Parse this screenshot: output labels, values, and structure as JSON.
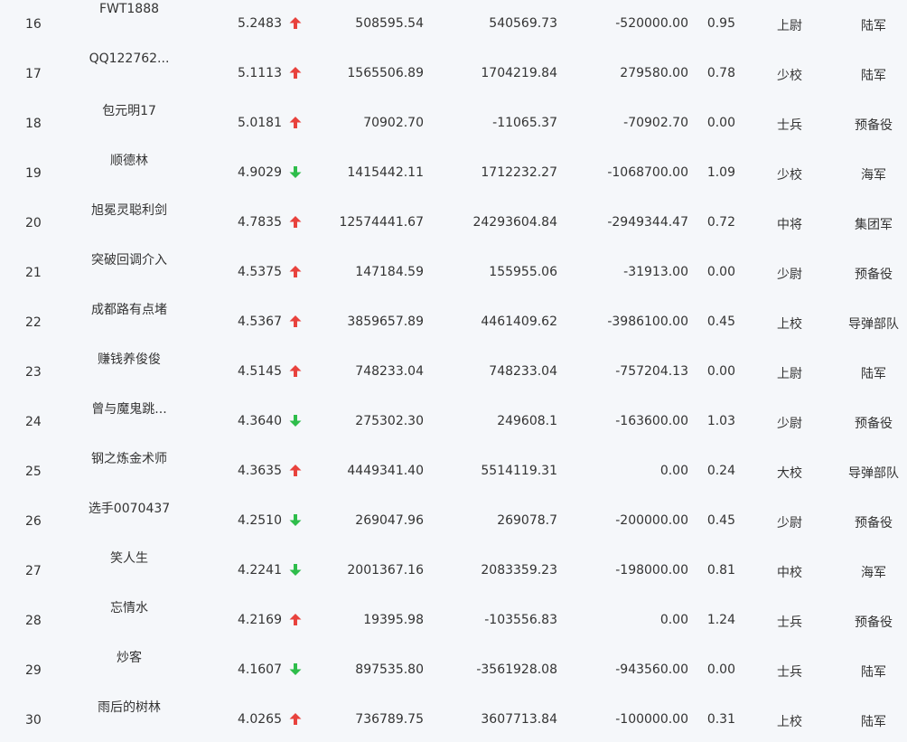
{
  "colors": {
    "up": "#e8423d",
    "down": "#2ebd4b",
    "text": "#333333",
    "background": "#f5f7fa"
  },
  "rows": [
    {
      "rank": "16",
      "name": "FWT1888",
      "score": "5.2483",
      "trend": "up",
      "v1": "508595.54",
      "v2": "540569.73",
      "v3": "-520000.00",
      "ratio": "0.95",
      "title": "上尉",
      "branch": "陆军"
    },
    {
      "rank": "17",
      "name": "QQ122762...",
      "score": "5.1113",
      "trend": "up",
      "v1": "1565506.89",
      "v2": "1704219.84",
      "v3": "279580.00",
      "ratio": "0.78",
      "title": "少校",
      "branch": "陆军"
    },
    {
      "rank": "18",
      "name": "包元明17",
      "score": "5.0181",
      "trend": "up",
      "v1": "70902.70",
      "v2": "-11065.37",
      "v3": "-70902.70",
      "ratio": "0.00",
      "title": "士兵",
      "branch": "预备役"
    },
    {
      "rank": "19",
      "name": "顺德林",
      "score": "4.9029",
      "trend": "down",
      "v1": "1415442.11",
      "v2": "1712232.27",
      "v3": "-1068700.00",
      "ratio": "1.09",
      "title": "少校",
      "branch": "海军"
    },
    {
      "rank": "20",
      "name": "旭冕灵聪利剑",
      "score": "4.7835",
      "trend": "up",
      "v1": "12574441.67",
      "v2": "24293604.84",
      "v3": "-2949344.47",
      "ratio": "0.72",
      "title": "中将",
      "branch": "集团军"
    },
    {
      "rank": "21",
      "name": "突破回调介入",
      "score": "4.5375",
      "trend": "up",
      "v1": "147184.59",
      "v2": "155955.06",
      "v3": "-31913.00",
      "ratio": "0.00",
      "title": "少尉",
      "branch": "预备役"
    },
    {
      "rank": "22",
      "name": "成都路有点堵",
      "score": "4.5367",
      "trend": "up",
      "v1": "3859657.89",
      "v2": "4461409.62",
      "v3": "-3986100.00",
      "ratio": "0.45",
      "title": "上校",
      "branch": "导弹部队"
    },
    {
      "rank": "23",
      "name": "赚钱养俊俊",
      "score": "4.5145",
      "trend": "up",
      "v1": "748233.04",
      "v2": "748233.04",
      "v3": "-757204.13",
      "ratio": "0.00",
      "title": "上尉",
      "branch": "陆军"
    },
    {
      "rank": "24",
      "name": "曾与魔鬼跳...",
      "score": "4.3640",
      "trend": "down",
      "v1": "275302.30",
      "v2": "249608.1",
      "v3": "-163600.00",
      "ratio": "1.03",
      "title": "少尉",
      "branch": "预备役"
    },
    {
      "rank": "25",
      "name": "钢之炼金术师",
      "score": "4.3635",
      "trend": "up",
      "v1": "4449341.40",
      "v2": "5514119.31",
      "v3": "0.00",
      "ratio": "0.24",
      "title": "大校",
      "branch": "导弹部队"
    },
    {
      "rank": "26",
      "name": "选手0070437",
      "score": "4.2510",
      "trend": "down",
      "v1": "269047.96",
      "v2": "269078.7",
      "v3": "-200000.00",
      "ratio": "0.45",
      "title": "少尉",
      "branch": "预备役"
    },
    {
      "rank": "27",
      "name": "笑人生",
      "score": "4.2241",
      "trend": "down",
      "v1": "2001367.16",
      "v2": "2083359.23",
      "v3": "-198000.00",
      "ratio": "0.81",
      "title": "中校",
      "branch": "海军"
    },
    {
      "rank": "28",
      "name": "忘情水",
      "score": "4.2169",
      "trend": "up",
      "v1": "19395.98",
      "v2": "-103556.83",
      "v3": "0.00",
      "ratio": "1.24",
      "title": "士兵",
      "branch": "预备役"
    },
    {
      "rank": "29",
      "name": "炒客",
      "score": "4.1607",
      "trend": "down",
      "v1": "897535.80",
      "v2": "-3561928.08",
      "v3": "-943560.00",
      "ratio": "0.00",
      "title": "士兵",
      "branch": "陆军"
    },
    {
      "rank": "30",
      "name": "雨后的树林",
      "score": "4.0265",
      "trend": "up",
      "v1": "736789.75",
      "v2": "3607713.84",
      "v3": "-100000.00",
      "ratio": "0.31",
      "title": "上校",
      "branch": "陆军"
    }
  ]
}
